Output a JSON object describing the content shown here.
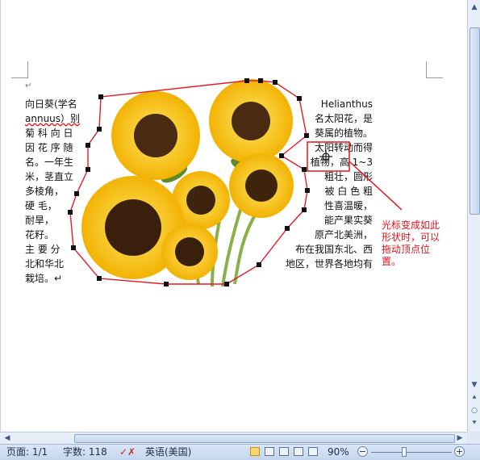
{
  "document": {
    "para_mark": "↵",
    "left_column": {
      "lines": [
        "向日葵(学名",
        "annuus）别",
        "菊 科 向 日",
        "因 花 序 随",
        "名。一年生",
        "米，茎直立",
        "多棱角，",
        "硬 毛，",
        "耐旱，",
        "花籽。",
        "主 要 分",
        "北和华北",
        "栽培。↵"
      ]
    },
    "right_column": {
      "lines": [
        "Helianthus",
        "名太阳花，是",
        "葵属的植物。",
        "太阳转动而得",
        "植物，高 1~3",
        "粗壮，圆形",
        "被 白 色 粗",
        "性喜温暖，",
        "能产果实葵",
        "原产北美洲，",
        "布在我国东北、西",
        "地区，世界各地均有"
      ]
    },
    "annotation": {
      "lines": [
        "光标变成如此",
        "形状时，可以",
        "拖动顶点位",
        "置。"
      ]
    },
    "image": {
      "name": "sunflower-image",
      "description_icon": "sunflower"
    }
  },
  "statusbar": {
    "page": "页面: 1/1",
    "words": "字数: 118",
    "language": "英语(美国)",
    "zoom": "90%",
    "zoom_minus": "−",
    "zoom_plus": "+"
  },
  "scrollbar": {
    "up": "▲",
    "down": "▼",
    "prev": "⯅",
    "select": "○",
    "next": "⯆",
    "left": "◀",
    "right": "▶"
  },
  "colors": {
    "wrap_outline": "#e51c23",
    "vertex": "#111111",
    "accent": "#e0141e"
  }
}
